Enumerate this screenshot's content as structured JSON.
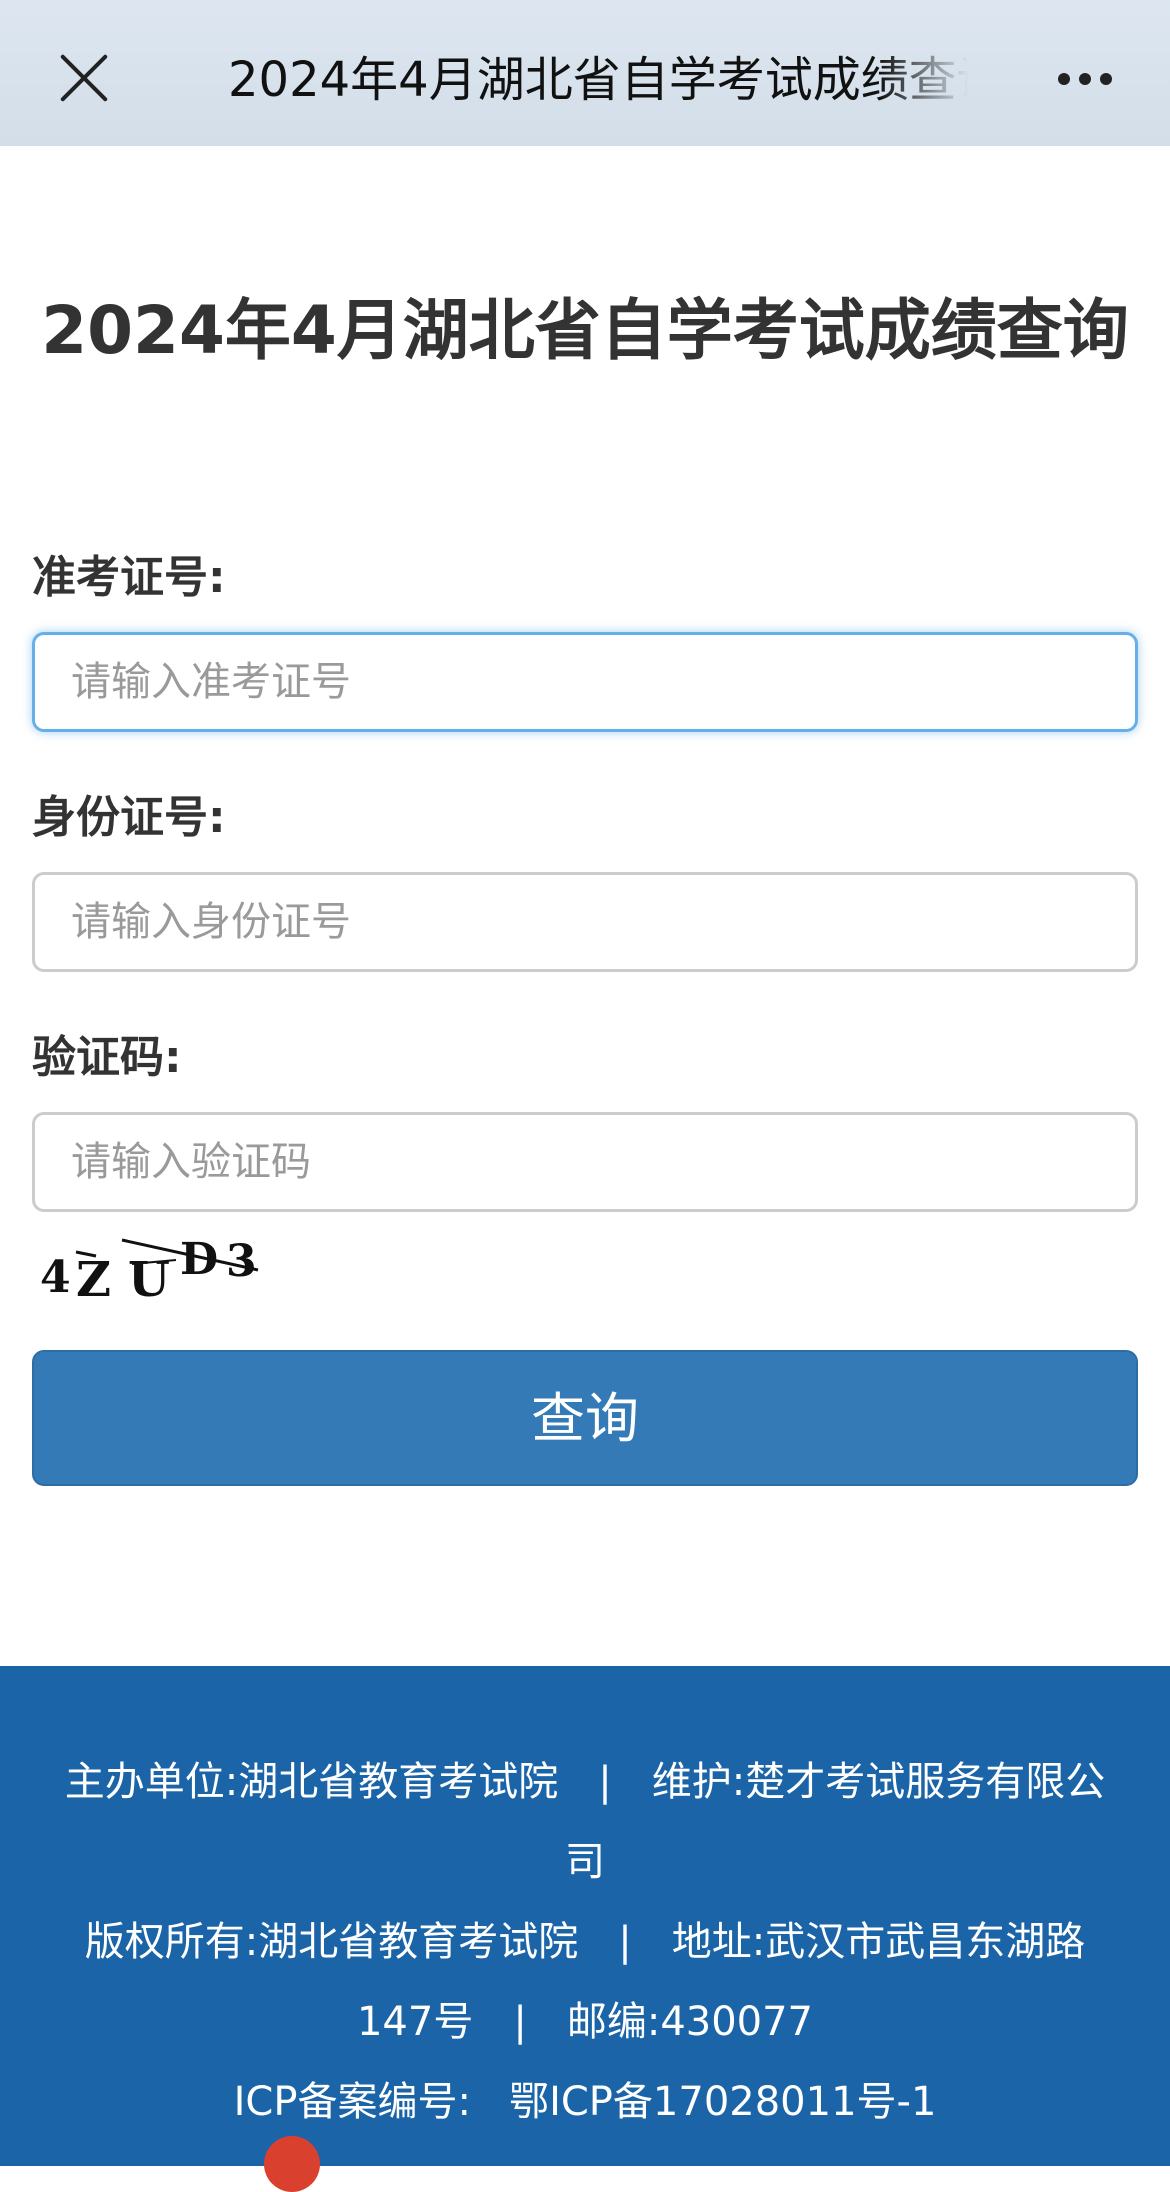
{
  "topbar": {
    "title": "2024年4月湖北省自学考试成绩查询",
    "close_icon": "close-icon",
    "more_icon": "more-dots-icon"
  },
  "page": {
    "title": "2024年4月湖北省自学考试成绩查询"
  },
  "form": {
    "admission_label": "准考证号:",
    "admission_placeholder": "请输入准考证号",
    "admission_value": "",
    "id_label": "身份证号:",
    "id_placeholder": "请输入身份证号",
    "id_value": "",
    "captcha_label": "验证码:",
    "captcha_placeholder": "请输入验证码",
    "captcha_value": "",
    "captcha_text": "4ZUD3",
    "submit_label": "查询"
  },
  "footer": {
    "organizer_label": "主办单位:",
    "organizer": "湖北省教育考试院",
    "maintainer_label": "维护:",
    "maintainer": "楚才考试服务有限公司",
    "copyright_label": "版权所有:",
    "copyright": "湖北省教育考试院",
    "address_label": "地址:",
    "address": "武汉市武昌东湖路147号",
    "postcode_label": "邮编:",
    "postcode": "430077",
    "icp_label": "ICP备案编号:",
    "icp": "鄂ICP备17028011号-1",
    "separator": "|"
  },
  "colors": {
    "primary": "#337ab7",
    "footer_bg": "#1b64a8",
    "focus_border": "#66afe9"
  }
}
